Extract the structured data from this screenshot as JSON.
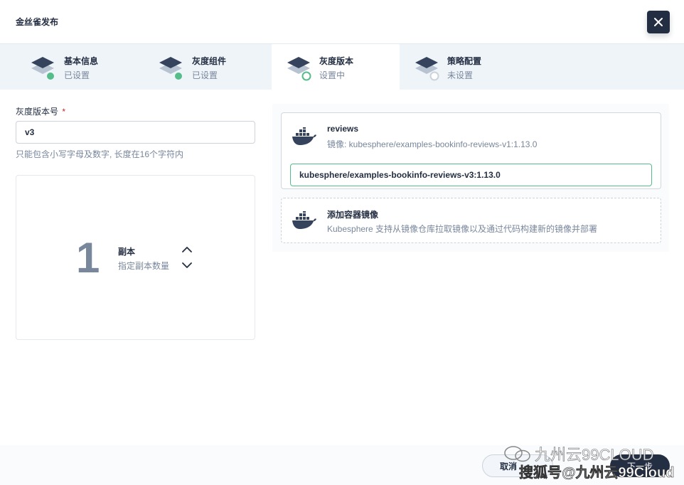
{
  "modal": {
    "title": "金丝雀发布"
  },
  "steps": [
    {
      "title": "基本信息",
      "status": "已设置",
      "state": "done"
    },
    {
      "title": "灰度组件",
      "status": "已设置",
      "state": "done"
    },
    {
      "title": "灰度版本",
      "status": "设置中",
      "state": "active"
    },
    {
      "title": "策略配置",
      "status": "未设置",
      "state": "pending"
    }
  ],
  "form": {
    "version_label": "灰度版本号",
    "required_mark": "*",
    "version_value": "v3",
    "version_hint": "只能包含小写字母及数字, 长度在16个字符内"
  },
  "replicas": {
    "count": "1",
    "title": "副本",
    "desc": "指定副本数量"
  },
  "container": {
    "name": "reviews",
    "image_text": "镜像: kubesphere/examples-bookinfo-reviews-v1:1.13.0",
    "new_image_value": "kubesphere/examples-bookinfo-reviews-v3:1.13.0"
  },
  "add_container": {
    "title": "添加容器镜像",
    "desc": "Kubesphere 支持从镜像仓库拉取镜像以及通过代码构建新的镜像并部署"
  },
  "footer": {
    "cancel_label": "取消",
    "next_label": "下一步"
  },
  "watermark": {
    "line1": "九州云99CLOUD",
    "line2": "搜狐号@九州云99Cloud"
  },
  "colors": {
    "primary_dark": "#242e42",
    "success_green": "#55bc8a",
    "muted_text": "#79879c",
    "step_bar_bg": "#eff4f9"
  },
  "icons": {
    "close": "close-icon",
    "step": "layers-icon",
    "container": "docker-icon",
    "up": "chevron-up-icon",
    "down": "chevron-down-icon"
  }
}
